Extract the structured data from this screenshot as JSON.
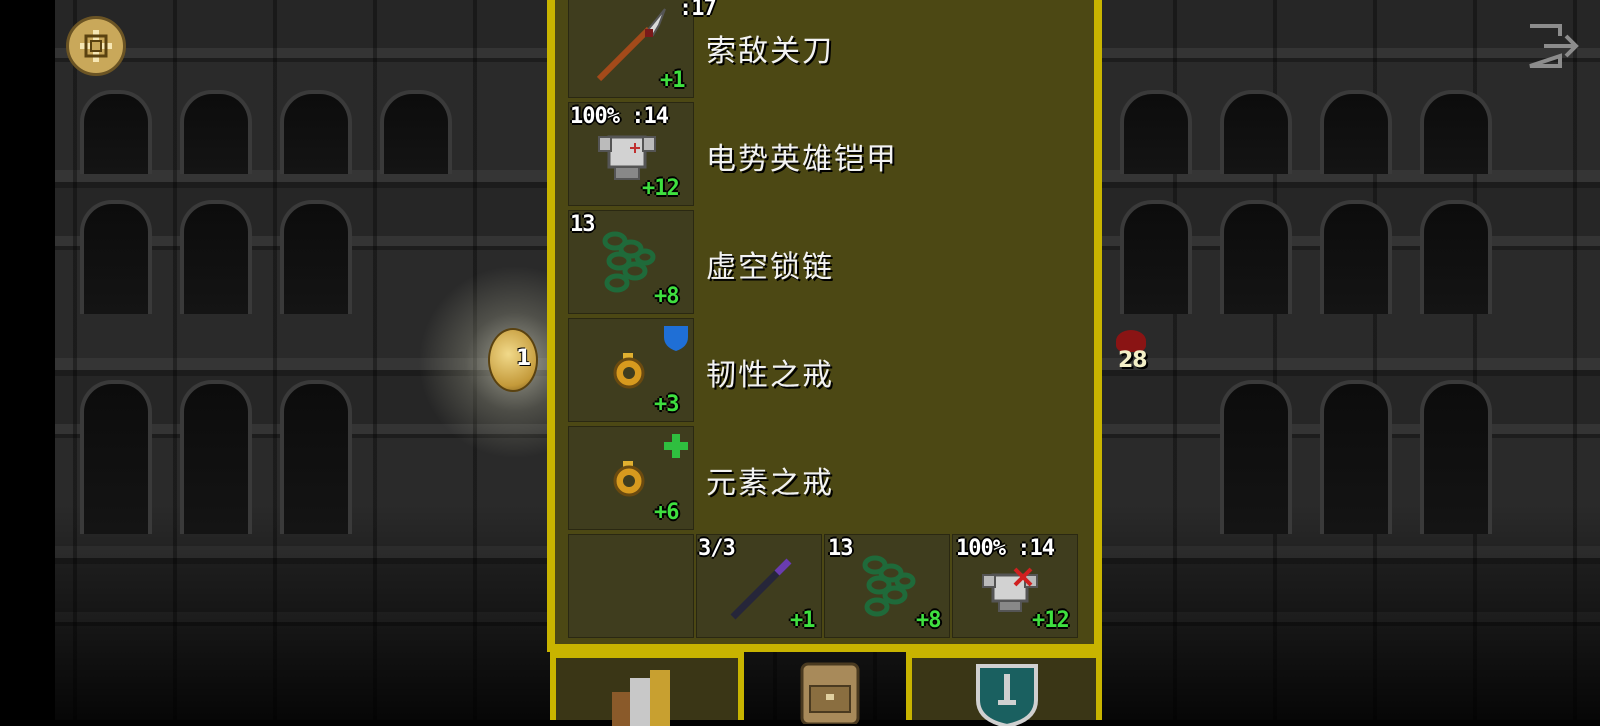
{
  "hud": {
    "menu_icon": "rune-compass-icon",
    "exit_icon": "exit-door-icon",
    "hero_level": "1",
    "enemy_marker_value": "28"
  },
  "inventory": {
    "equipment": [
      {
        "name": "索敌关刀",
        "icon": "glaive-icon",
        "top_badge": ":17",
        "upgrade": "+1",
        "corner_icon": ""
      },
      {
        "name": "电势英雄铠甲",
        "icon": "armor-icon",
        "top_badge": "100% :14",
        "upgrade": "+12",
        "corner_icon": ""
      },
      {
        "name": "虚空锁链",
        "icon": "chain-icon",
        "top_badge": "13",
        "upgrade": "+8",
        "corner_icon": ""
      },
      {
        "name": "韧性之戒",
        "icon": "ring-icon",
        "top_badge": "",
        "upgrade": "+3",
        "corner_icon": "blue-shield-icon"
      },
      {
        "name": "元素之戒",
        "icon": "ring-icon",
        "top_badge": "",
        "upgrade": "+6",
        "corner_icon": "green-plus-icon"
      }
    ],
    "quickslots": [
      {
        "icon": "empty-slot",
        "top_badge": "",
        "upgrade": ""
      },
      {
        "icon": "wand-icon",
        "top_badge": "3/3",
        "upgrade": "+1"
      },
      {
        "icon": "chain-icon",
        "top_badge": "13",
        "upgrade": "+8"
      },
      {
        "icon": "armor-cursed-icon",
        "top_badge": "100% :14",
        "upgrade": "+12"
      }
    ]
  },
  "toolbar": {
    "left_icon": "books-icon",
    "center_icon": "backpack-icon",
    "right_icon": "sword-shield-icon"
  },
  "colors": {
    "frame": "#c8b400",
    "panel": "#4c4814",
    "slot": "#3f3d1e",
    "upgrade_text": "#3fe03f"
  }
}
